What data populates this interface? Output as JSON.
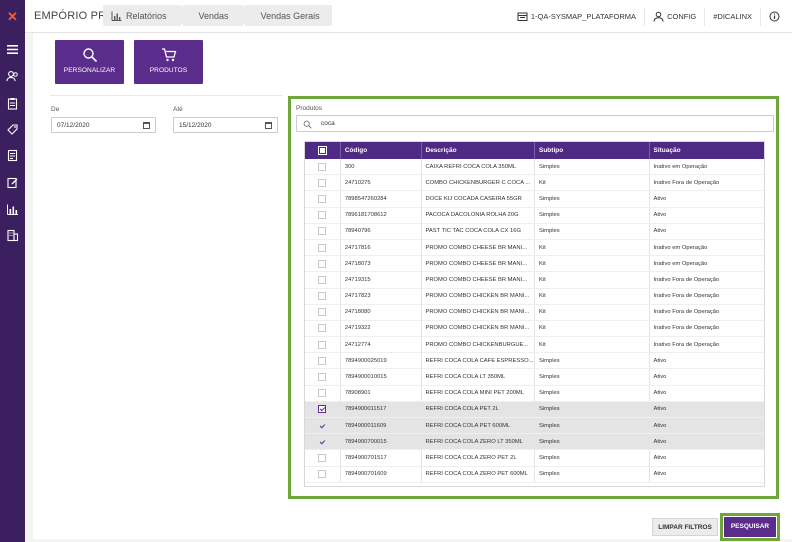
{
  "app": {
    "brand": "EMPÓRIO PRO"
  },
  "breadcrumb": [
    "Relatórios",
    "Vendas",
    "Vendas Gerais"
  ],
  "topbar": {
    "platform": "1-QA-SYSMAP_PLATAFORMA",
    "config": "CONFIG",
    "tag": "#DICALINX"
  },
  "actions": {
    "personalize": "PERSONALIZAR",
    "products": "PRODUTOS"
  },
  "filters": {
    "from_label": "De",
    "from_value": "07/12/2020",
    "to_label": "Até",
    "to_value": "15/12/2020",
    "products_label": "Produtos",
    "search_value": "coca"
  },
  "table": {
    "headers": [
      "Código",
      "Descrição",
      "Subtipo",
      "Situação"
    ],
    "rows": [
      {
        "code": "300",
        "desc": "CAIXA REFRI COCA COLA 350ML",
        "subtype": "Simples",
        "status": "Inativo em Operação",
        "check": "none",
        "sel": false
      },
      {
        "code": "24710275",
        "desc": "COMBO CHICKENBURGER C COCA ...",
        "subtype": "Kit",
        "status": "Inativo Fora de Operação",
        "check": "none",
        "sel": false
      },
      {
        "code": "7898547260284",
        "desc": "DOCE KIJ COCADA CASEIRA 55GR",
        "subtype": "Simples",
        "status": "Ativo",
        "check": "none",
        "sel": false
      },
      {
        "code": "7896181708612",
        "desc": "PACOCA DACOLONIA ROLHA 20G",
        "subtype": "Simples",
        "status": "Ativo",
        "check": "none",
        "sel": false
      },
      {
        "code": "78940796",
        "desc": "PAST TIC TAC COCA COLA CX 16G",
        "subtype": "Simples",
        "status": "Ativo",
        "check": "none",
        "sel": false
      },
      {
        "code": "24717816",
        "desc": "PROMO COMBO CHEESE BR MANI...",
        "subtype": "Kit",
        "status": "Inativo em Operação",
        "check": "none",
        "sel": false
      },
      {
        "code": "24718073",
        "desc": "PROMO COMBO CHEESE BR MANI...",
        "subtype": "Kit",
        "status": "Inativo em Operação",
        "check": "none",
        "sel": false
      },
      {
        "code": "24719315",
        "desc": "PROMO COMBO CHEESE BR MANI...",
        "subtype": "Kit",
        "status": "Inativo Fora de Operação",
        "check": "none",
        "sel": false
      },
      {
        "code": "24717823",
        "desc": "PROMO COMBO CHICKEN BR MANI...",
        "subtype": "Kit",
        "status": "Inativo Fora de Operação",
        "check": "none",
        "sel": false
      },
      {
        "code": "24718080",
        "desc": "PROMO COMBO CHICKEN BR MANI...",
        "subtype": "Kit",
        "status": "Inativo Fora de Operação",
        "check": "none",
        "sel": false
      },
      {
        "code": "24719322",
        "desc": "PROMO COMBO CHICKEN BR MANI...",
        "subtype": "Kit",
        "status": "Inativo Fora de Operação",
        "check": "none",
        "sel": false
      },
      {
        "code": "24712774",
        "desc": "PROMO COMBO CHICKENBURGUE...",
        "subtype": "Kit",
        "status": "Inativo Fora de Operação",
        "check": "none",
        "sel": false
      },
      {
        "code": "7894900025019",
        "desc": "REFRI COCA COLA CAFE ESPRESSO...",
        "subtype": "Simples",
        "status": "Ativo",
        "check": "none",
        "sel": false
      },
      {
        "code": "7894900010015",
        "desc": "REFRI COCA COLA LT 350ML",
        "subtype": "Simples",
        "status": "Ativo",
        "check": "none",
        "sel": false
      },
      {
        "code": "78908901",
        "desc": "REFRI COCA COLA MINI PET 200ML",
        "subtype": "Simples",
        "status": "Ativo",
        "check": "none",
        "sel": false
      },
      {
        "code": "7894900011517",
        "desc": "REFRI COCA COLA PET 2L",
        "subtype": "Simples",
        "status": "Ativo",
        "check": "box",
        "sel": true
      },
      {
        "code": "7894900011609",
        "desc": "REFRI COCA COLA PET 600ML",
        "subtype": "Simples",
        "status": "Ativo",
        "check": "tick",
        "sel": true
      },
      {
        "code": "7894900700015",
        "desc": "REFRI COCA COLA ZERO LT 350ML",
        "subtype": "Simples",
        "status": "Ativo",
        "check": "tick",
        "sel": true
      },
      {
        "code": "7894900701517",
        "desc": "REFRI COCA COLA ZERO PET 2L",
        "subtype": "Simples",
        "status": "Ativo",
        "check": "none",
        "sel": false
      },
      {
        "code": "7894900701609",
        "desc": "REFRI COCA COLA ZERO PET 600ML",
        "subtype": "Simples",
        "status": "Ativo",
        "check": "none",
        "sel": false
      }
    ]
  },
  "buttons": {
    "clear": "LIMPAR FILTROS",
    "search": "PESQUISAR"
  },
  "colors": {
    "sidebar": "#3b1f5e",
    "primary": "#5a2d8c",
    "highlight": "#6ea63a"
  }
}
